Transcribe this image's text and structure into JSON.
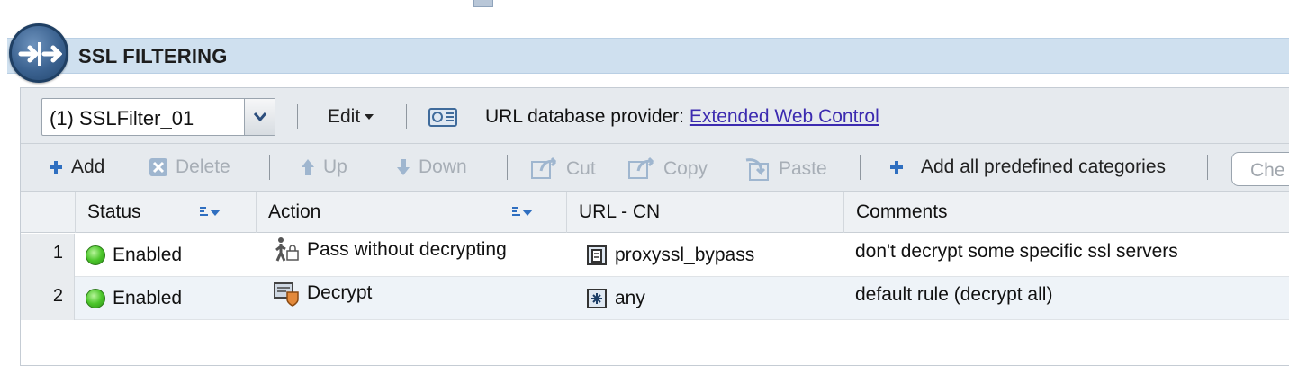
{
  "header": {
    "title": "SSL FILTERING"
  },
  "selector": {
    "value": "(1) SSLFilter_01"
  },
  "toolbar1": {
    "edit_label": "Edit",
    "db_label": "URL database provider:",
    "db_link": "Extended Web Control"
  },
  "toolbar2": {
    "add": "Add",
    "delete": "Delete",
    "up": "Up",
    "down": "Down",
    "cut": "Cut",
    "copy": "Copy",
    "paste": "Paste",
    "add_all": "Add all predefined categories",
    "check_placeholder": "Che"
  },
  "table": {
    "columns": [
      "Status",
      "Action",
      "URL - CN",
      "Comments"
    ],
    "rows": [
      {
        "num": "1",
        "status": "Enabled",
        "action": "Pass without decrypting",
        "url": "proxyssl_bypass",
        "comment": "don't decrypt some specific ssl servers"
      },
      {
        "num": "2",
        "status": "Enabled",
        "action": "Decrypt",
        "url": "any",
        "comment": "default rule (decrypt all)"
      }
    ]
  },
  "colors": {
    "header_bg": "#cfe0ef",
    "toolbar_bg": "#e6eaee",
    "link": "#3c2bb0",
    "status_ok": "#4cc62b",
    "add_icon": "#2f6fc0"
  }
}
